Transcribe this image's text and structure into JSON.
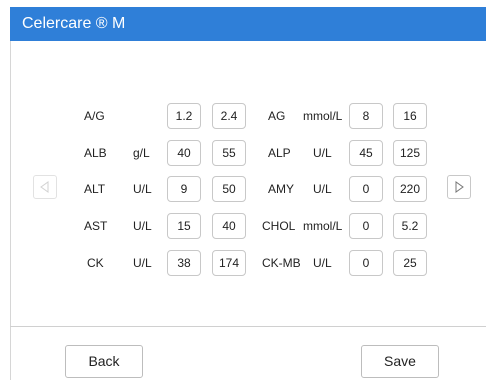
{
  "window": {
    "title": "Celercare ® M"
  },
  "nav": {
    "prev_icon": "triangle-left-icon",
    "next_icon": "triangle-right-icon",
    "prev_enabled": false
  },
  "rows": [
    {
      "left": {
        "name": "A/G",
        "unit": "",
        "low": "1.2",
        "high": "2.4"
      },
      "right": {
        "name": "AG",
        "unit": "mmol/L",
        "low": "8",
        "high": "16"
      }
    },
    {
      "left": {
        "name": "ALB",
        "unit": "g/L",
        "low": "40",
        "high": "55"
      },
      "right": {
        "name": "ALP",
        "unit": "U/L",
        "low": "45",
        "high": "125"
      }
    },
    {
      "left": {
        "name": "ALT",
        "unit": "U/L",
        "low": "9",
        "high": "50"
      },
      "right": {
        "name": "AMY",
        "unit": "U/L",
        "low": "0",
        "high": "220"
      }
    },
    {
      "left": {
        "name": "AST",
        "unit": "U/L",
        "low": "15",
        "high": "40"
      },
      "right": {
        "name": "CHOL",
        "unit": "mmol/L",
        "low": "0",
        "high": "5.2"
      }
    },
    {
      "left": {
        "name": "CK",
        "unit": "U/L",
        "low": "38",
        "high": "174"
      },
      "right": {
        "name": "CK-MB",
        "unit": "U/L",
        "low": "0",
        "high": "25"
      }
    }
  ],
  "footer": {
    "back_label": "Back",
    "save_label": "Save"
  },
  "colors": {
    "header": "#2f7fd8",
    "border": "#c8c8c8"
  }
}
